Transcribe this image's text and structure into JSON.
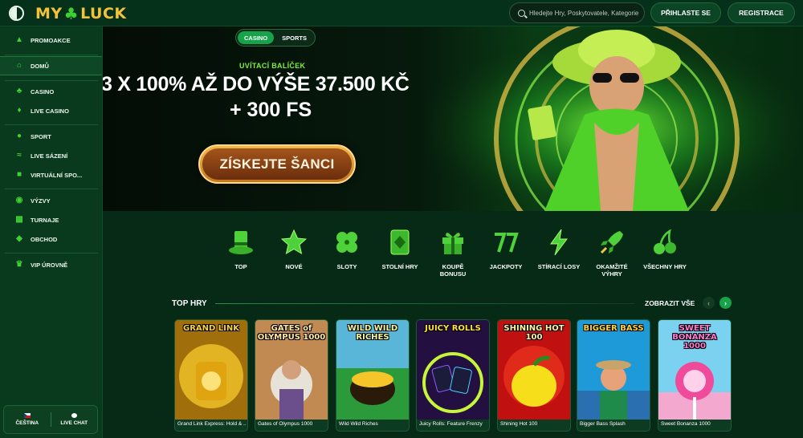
{
  "header": {
    "logo_left": "MY",
    "logo_right": "LUCK",
    "search_placeholder": "Hledejte Hry, Poskytovatele, Kategorie",
    "login_label": "PŘIHLASTE SE",
    "register_label": "REGISTRACE"
  },
  "sidebar": {
    "items": [
      {
        "label": "PROMOAKCE",
        "icon": "flame-icon"
      },
      {
        "label": "DOMŮ",
        "icon": "home-icon"
      },
      {
        "label": "CASINO",
        "icon": "clover-icon"
      },
      {
        "label": "LIVE CASINO",
        "icon": "live-casino-icon"
      },
      {
        "label": "SPORT",
        "icon": "ball-icon"
      },
      {
        "label": "LIVE SÁZENÍ",
        "icon": "live-bet-icon"
      },
      {
        "label": "VIRTUÁLNÍ SPO...",
        "icon": "gamepad-icon"
      },
      {
        "label": "VÝZVY",
        "icon": "target-icon"
      },
      {
        "label": "TURNAJE",
        "icon": "podium-icon"
      },
      {
        "label": "OBCHOD",
        "icon": "shop-icon"
      },
      {
        "label": "VIP ÚROVNĚ",
        "icon": "crown-icon"
      }
    ],
    "language_label": "ČEŠTINA",
    "chat_label": "LIVE CHAT"
  },
  "hero": {
    "tabs": [
      "CASINO",
      "SPORTS"
    ],
    "active_tab": "CASINO",
    "welcome": "UVÍTACÍ BALÍČEK",
    "promo_line1": "3 X 100% AŽ DO VÝŠE 37.500 KČ",
    "promo_line2": "+ 300 FS",
    "cta_label": "ZÍSKEJTE ŠANCI"
  },
  "categories": [
    {
      "label": "TOP",
      "icon": "top-hat-icon"
    },
    {
      "label": "NOVÉ",
      "icon": "star-icon"
    },
    {
      "label": "SLOTY",
      "icon": "clover-icon"
    },
    {
      "label": "STOLNÍ HRY",
      "icon": "card-icon"
    },
    {
      "label": "KOUPĚ BONUSU",
      "icon": "gift-icon"
    },
    {
      "label": "JACKPOTY",
      "icon": "sevens-icon"
    },
    {
      "label": "STÍRACÍ LOSY",
      "icon": "lightning-icon"
    },
    {
      "label": "OKAMŽITÉ VÝHRY",
      "icon": "rocket-icon"
    },
    {
      "label": "VŠECHNY HRY",
      "icon": "cherries-icon"
    }
  ],
  "top_games": {
    "title": "TOP HRY",
    "show_all": "ZOBRAZIT VŠE",
    "games": [
      {
        "art_title": "GRAND LINK",
        "name": "Grand Link Express: Hold & ..."
      },
      {
        "art_title": "GATES of OLYMPUS 1000",
        "name": "Gates of Olympus 1000"
      },
      {
        "art_title": "WILD WILD RICHES",
        "name": "Wild Wild Riches"
      },
      {
        "art_title": "JUICY ROLLS",
        "name": "Juicy Rolls: Feature Frenzy"
      },
      {
        "art_title": "SHINING HOT 100",
        "name": "Shining Hot 100"
      },
      {
        "art_title": "BIGGER BASS",
        "name": "Bigger Bass Splash"
      },
      {
        "art_title": "SWEET BONANZA 1000",
        "name": "Sweet Bonanza 1000"
      }
    ]
  },
  "colors": {
    "accent_green": "#16a34a",
    "neon_green": "#3fd135",
    "gold": "#f4c23a",
    "background": "#062a16"
  }
}
